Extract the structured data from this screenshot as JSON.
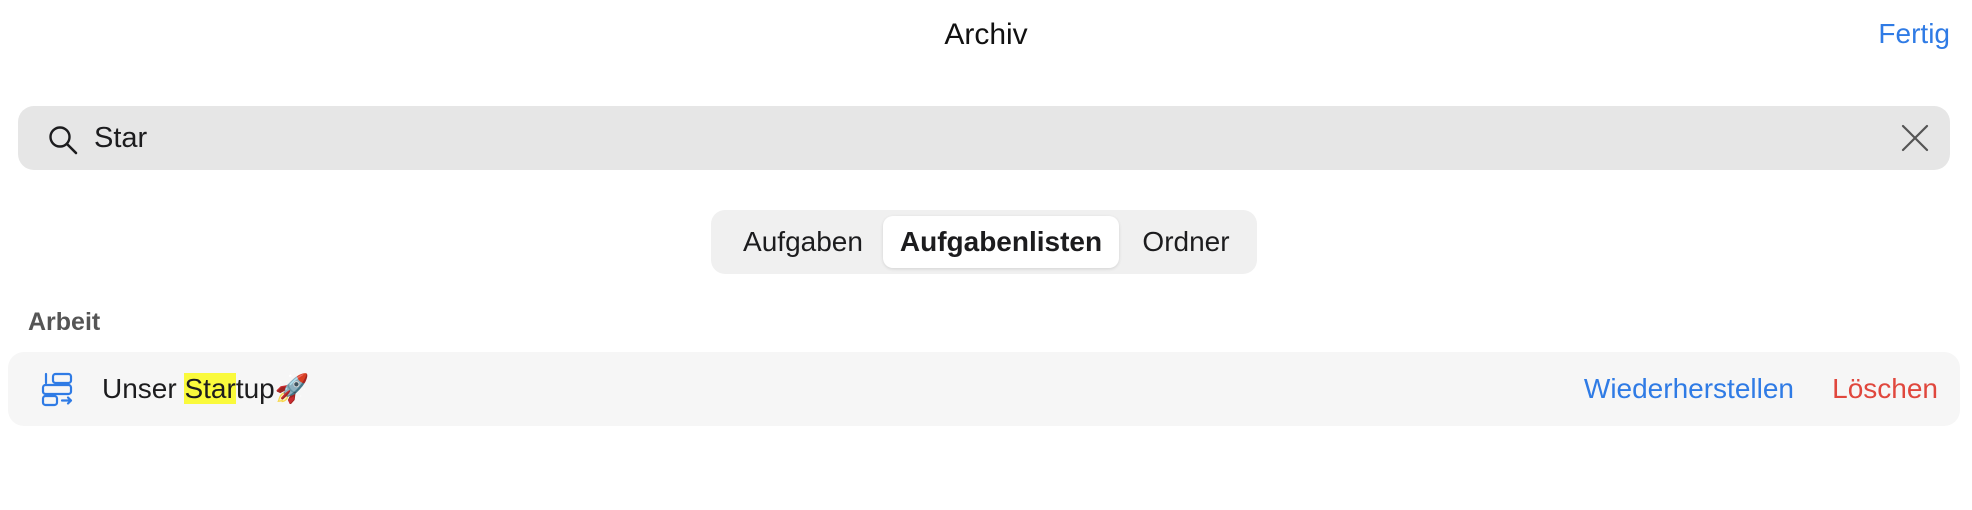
{
  "header": {
    "title": "Archiv",
    "done_label": "Fertig"
  },
  "search": {
    "value": "Star",
    "icon": "search-icon",
    "clear_icon": "close-icon"
  },
  "segments": [
    {
      "label": "Aufgaben",
      "selected": false
    },
    {
      "label": "Aufgabenlisten",
      "selected": true
    },
    {
      "label": "Ordner",
      "selected": false
    }
  ],
  "sections": [
    {
      "header": "Arbeit",
      "items": [
        {
          "icon": "task-list-icon",
          "title_prefix": "Unser ",
          "title_match": "Star",
          "title_suffix": "tup🚀",
          "restore_label": "Wiederherstellen",
          "delete_label": "Löschen"
        }
      ]
    }
  ],
  "colors": {
    "accent": "#2f7be5",
    "destructive": "#e0473d",
    "highlight": "#fafa3c"
  }
}
